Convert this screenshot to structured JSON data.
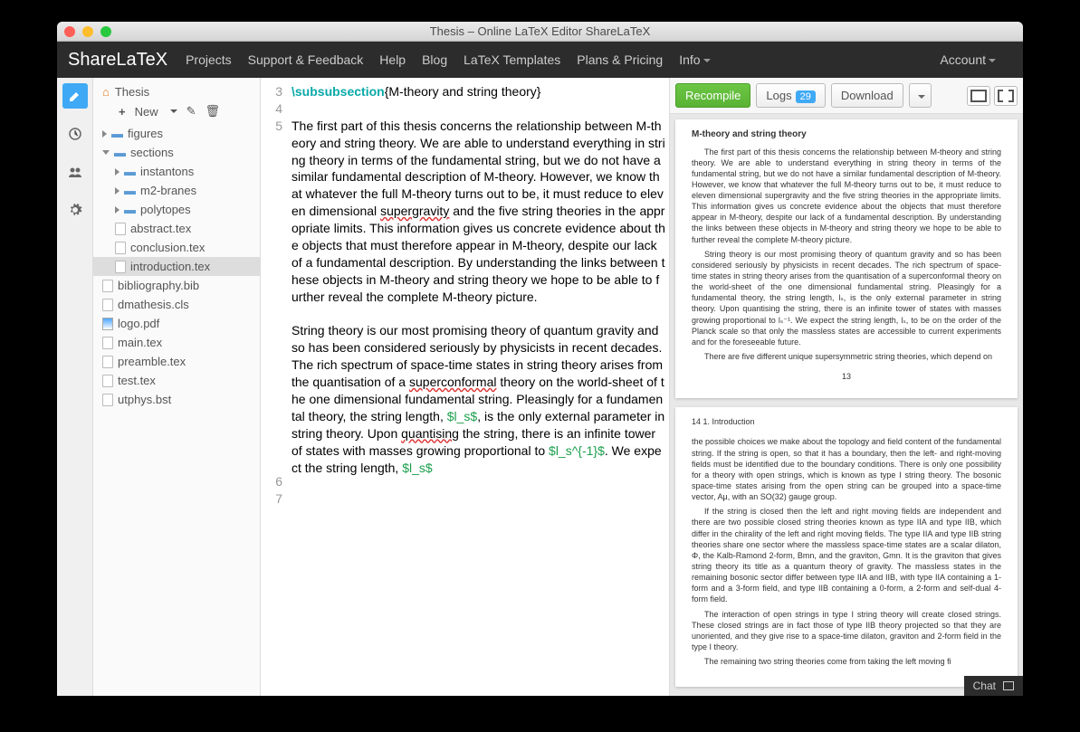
{
  "window_title": "Thesis – Online LaTeX Editor ShareLaTeX",
  "brand": "ShareLaTeX",
  "menu": {
    "projects": "Projects",
    "support": "Support & Feedback",
    "help": "Help",
    "blog": "Blog",
    "templates": "LaTeX Templates",
    "plans": "Plans & Pricing",
    "info": "Info",
    "account": "Account"
  },
  "tree": {
    "root": "Thesis",
    "new": "New",
    "items": [
      {
        "t": "folder",
        "label": "figures",
        "open": false,
        "d": 0
      },
      {
        "t": "folder",
        "label": "sections",
        "open": true,
        "d": 0
      },
      {
        "t": "folder",
        "label": "instantons",
        "open": false,
        "d": 1
      },
      {
        "t": "folder",
        "label": "m2-branes",
        "open": false,
        "d": 1
      },
      {
        "t": "folder",
        "label": "polytopes",
        "open": false,
        "d": 1
      },
      {
        "t": "file",
        "label": "abstract.tex",
        "d": 1
      },
      {
        "t": "file",
        "label": "conclusion.tex",
        "d": 1
      },
      {
        "t": "file",
        "label": "introduction.tex",
        "d": 1,
        "sel": true
      },
      {
        "t": "file",
        "label": "bibliography.bib",
        "d": 0
      },
      {
        "t": "file",
        "label": "dmathesis.cls",
        "d": 0
      },
      {
        "t": "pdf",
        "label": "logo.pdf",
        "d": 0
      },
      {
        "t": "file",
        "label": "main.tex",
        "d": 0
      },
      {
        "t": "file",
        "label": "preamble.tex",
        "d": 0
      },
      {
        "t": "file",
        "label": "test.tex",
        "d": 0
      },
      {
        "t": "file",
        "label": "utphys.bst",
        "d": 0
      }
    ]
  },
  "editor": {
    "lines": [
      3,
      4,
      5,
      6,
      7
    ],
    "l3_cmd": "\\subsubsection",
    "l3_arg": "{M-theory and string theory}",
    "p5a": "The first part of this thesis concerns the relationship between M-theory and string theory. We are able to understand everything in string theory in terms of the fundamental string, but we do not have a similar fundamental description of M-theory. However, we know that whatever the full M-theory turns out to be, it must reduce to eleven dimensional ",
    "p5_err1": "supergravity",
    "p5b": " and the five string theories in the appropriate limits. This information gives us concrete evidence about the objects that must therefore appear in M-theory, despite our lack of a fundamental description. By understanding the links between these objects in M-theory and string theory we hope to be able to further reveal the complete M-theory picture.",
    "p7a": "String theory is our most promising theory of quantum gravity and so has been considered seriously by physicists in recent decades. The rich spectrum of space-time states in string theory arises from the quantisation of a ",
    "p7_err1": "superconformal",
    "p7b": " theory on the world-sheet of the one dimensional fundamental string. Pleasingly for a fundamental theory, the string length, ",
    "p7_m1": "$l_s$",
    "p7c": ", is the only external parameter in string theory. Upon ",
    "p7_err2": "quantising",
    "p7d": " the string, there is an infinite tower of states with masses growing proportional to ",
    "p7_m2": "$l_s^{-1}$",
    "p7e": ". We expect the string length, ",
    "p7_m3": "$l_s$"
  },
  "toolbar": {
    "recompile": "Recompile",
    "logs": "Logs",
    "logs_n": "29",
    "download": "Download"
  },
  "pdf": {
    "p1_title": "M-theory and string theory",
    "p1_a": "The first part of this thesis concerns the relationship between M-theory and string theory. We are able to understand everything in string theory in terms of the fundamental string, but we do not have a similar fundamental description of M-theory. However, we know that whatever the full M-theory turns out to be, it must reduce to eleven dimensional supergravity and the five string theories in the appropriate limits. This information gives us concrete evidence about the objects that must therefore appear in M-theory, despite our lack of a fundamental description. By understanding the links between these objects in M-theory and string theory we hope to be able to further reveal the complete M-theory picture.",
    "p1_b": "String theory is our most promising theory of quantum gravity and so has been considered seriously by physicists in recent decades. The rich spectrum of space-time states in string theory arises from the quantisation of a superconformal theory on the world-sheet of the one dimensional fundamental string. Pleasingly for a fundamental theory, the string length, lₛ, is the only external parameter in string theory. Upon quantising the string, there is an infinite tower of states with masses growing proportional to lₛ⁻¹. We expect the string length, lₛ, to be on the order of the Planck scale so that only the massless states are accessible to current experiments and for the foreseeable future.",
    "p1_c": "There are five different unique supersymmetric string theories, which depend on",
    "p1_n": "13",
    "p2_hd": "14      1. Introduction",
    "p2_a": "the possible choices we make about the topology and field content of the fundamental string. If the string is open, so that it has a boundary, then the left- and right-moving fields must be identified due to the boundary conditions. There is only one possibility for a theory with open strings, which is known as type I string theory. The bosonic space-time states arising from the open string can be grouped into a space-time vector, Aμ, with an SO(32) gauge group.",
    "p2_b": "If the string is closed then the left and right moving fields are independent and there are two possible closed string theories known as type IIA and type IIB, which differ in the chirality of the left and right moving fields. The type IIA and type IIB string theories share one sector where the massless space-time states are a scalar dilaton, Φ, the Kalb-Ramond 2-form, Bmn, and the graviton, Gmn. It is the graviton that gives string theory its title as a quantum theory of gravity. The massless states in the remaining bosonic sector differ between type IIA and IIB, with type IIA containing a 1-form and a 3-form field, and type IIB containing a 0-form, a 2-form and self-dual 4-form field.",
    "p2_c": "The interaction of open strings in type I string theory will create closed strings. These closed strings are in fact those of type IIB theory projected so that they are unoriented, and they give rise to a space-time dilaton, graviton and 2-form field in the type I theory.",
    "p2_d": "The remaining two string theories come from taking the left moving fi"
  },
  "chat": "Chat"
}
